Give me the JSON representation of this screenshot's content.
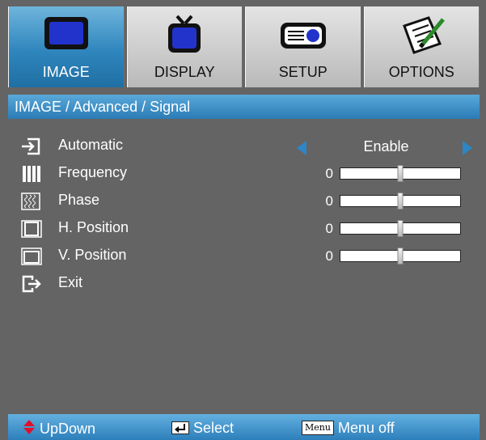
{
  "tabs": [
    {
      "label": "IMAGE",
      "icon": "monitor-icon",
      "active": true
    },
    {
      "label": "DISPLAY",
      "icon": "tv-icon",
      "active": false
    },
    {
      "label": "SETUP",
      "icon": "projector-icon",
      "active": false
    },
    {
      "label": "OPTIONS",
      "icon": "notepad-icon",
      "active": false
    }
  ],
  "breadcrumb": "IMAGE / Advanced / Signal",
  "menu": {
    "automatic": {
      "label": "Automatic",
      "value": "Enable",
      "icon": "input-arrow-icon"
    },
    "frequency": {
      "label": "Frequency",
      "value": "0",
      "level": 0.5,
      "icon": "bars-icon"
    },
    "phase": {
      "label": "Phase",
      "value": "0",
      "level": 0.5,
      "icon": "wave-icon"
    },
    "h_position": {
      "label": "H. Position",
      "value": "0",
      "level": 0.5,
      "icon": "h-position-icon"
    },
    "v_position": {
      "label": "V. Position",
      "value": "0",
      "level": 0.5,
      "icon": "v-position-icon"
    },
    "exit": {
      "label": "Exit",
      "icon": "exit-icon"
    }
  },
  "hints": {
    "updown": "UpDown",
    "select": "Select",
    "menu_key": "Menu",
    "menu_off": "Menu off"
  },
  "colors": {
    "accent": "#2d86c5",
    "background": "#646464",
    "active_tab": "#2f86bd"
  }
}
